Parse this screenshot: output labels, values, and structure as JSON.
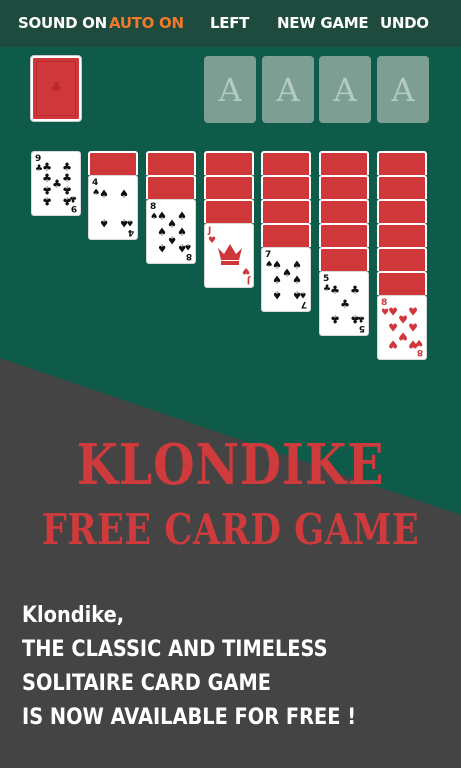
{
  "topbar": {
    "sound_label": "SOUND ON",
    "auto_label": "AUTO ON",
    "left_label": "LEFT",
    "new_game_label": "NEW GAME",
    "undo_label": "UNDO"
  },
  "foundations": [
    "A",
    "A",
    "A",
    "A"
  ],
  "tableau": [
    {
      "hidden": 0,
      "rank": "9",
      "suit": "♣",
      "color": "black"
    },
    {
      "hidden": 1,
      "rank": "4",
      "suit": "♠",
      "color": "black"
    },
    {
      "hidden": 2,
      "rank": "8",
      "suit": "♠",
      "color": "black"
    },
    {
      "hidden": 3,
      "rank": "J",
      "suit": "♥",
      "color": "red"
    },
    {
      "hidden": 4,
      "rank": "7",
      "suit": "♠",
      "color": "black"
    },
    {
      "hidden": 5,
      "rank": "5",
      "suit": "♣",
      "color": "black"
    },
    {
      "hidden": 6,
      "rank": "8",
      "suit": "♥",
      "color": "red"
    }
  ],
  "headline": {
    "line1": "KLONDIKE",
    "line2": "FREE CARD GAME"
  },
  "description": {
    "line1": "Klondike,",
    "line2": "THE CLASSIC AND TIMELESS",
    "line3": "SOLITAIRE CARD GAME",
    "line4": "IS NOW AVAILABLE FOR FREE !"
  },
  "colors": {
    "table_green": "#0d5b48",
    "topbar": "#1f4b3e",
    "dark_gray": "#444444",
    "card_red": "#d0373b",
    "accent_orange": "#f07a2a"
  }
}
